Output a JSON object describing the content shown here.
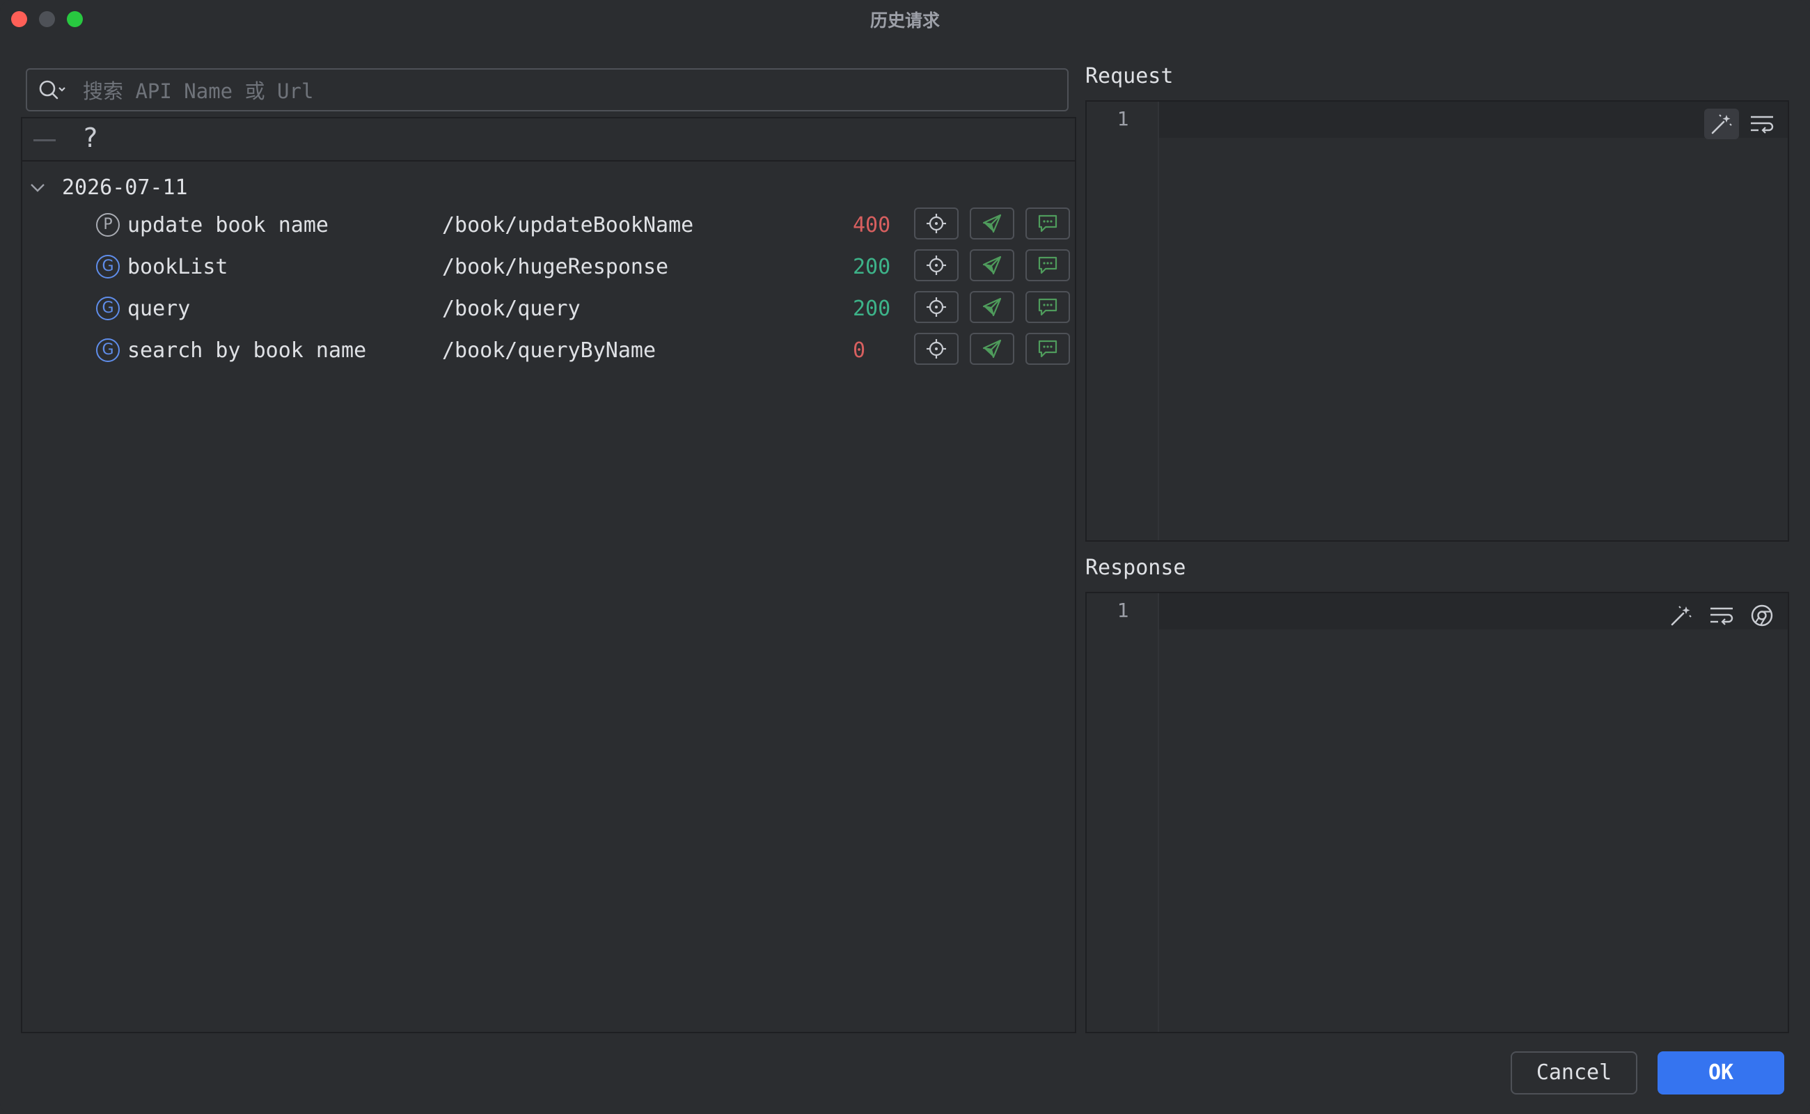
{
  "window": {
    "title": "历史请求"
  },
  "search": {
    "placeholder": "搜索 API Name 或 Url",
    "value": ""
  },
  "toolbar": {
    "remove_label": "—",
    "help_label": "?"
  },
  "history": {
    "group": {
      "date": "2026-07-11",
      "expanded": true
    },
    "rows": [
      {
        "method": "P",
        "name": "update book name",
        "url": "/book/updateBookName",
        "status": "400",
        "status_color": "#d75f5f"
      },
      {
        "method": "G",
        "name": "bookList",
        "url": "/book/hugeResponse",
        "status": "200",
        "status_color": "#3db389"
      },
      {
        "method": "G",
        "name": "query",
        "url": "/book/query",
        "status": "200",
        "status_color": "#3db389"
      },
      {
        "method": "G",
        "name": "search by book name",
        "url": "/book/queryByName",
        "status": "0",
        "status_color": "#d75f5f"
      }
    ],
    "row_actions": [
      "locate-icon",
      "send-icon",
      "message-icon"
    ]
  },
  "request": {
    "label": "Request",
    "line_number": "1",
    "tools": [
      "magic-wand-icon",
      "soft-wrap-icon"
    ]
  },
  "response": {
    "label": "Response",
    "line_number": "1",
    "tools": [
      "magic-wand-icon",
      "soft-wrap-icon",
      "browser-icon"
    ]
  },
  "footer": {
    "cancel_label": "Cancel",
    "ok_label": "OK"
  },
  "colors": {
    "background": "#2b2d30",
    "accent": "#3574f0",
    "method_post": "#a9acb3",
    "method_get": "#5f8dea",
    "action_icon": "#4f9c5c"
  }
}
